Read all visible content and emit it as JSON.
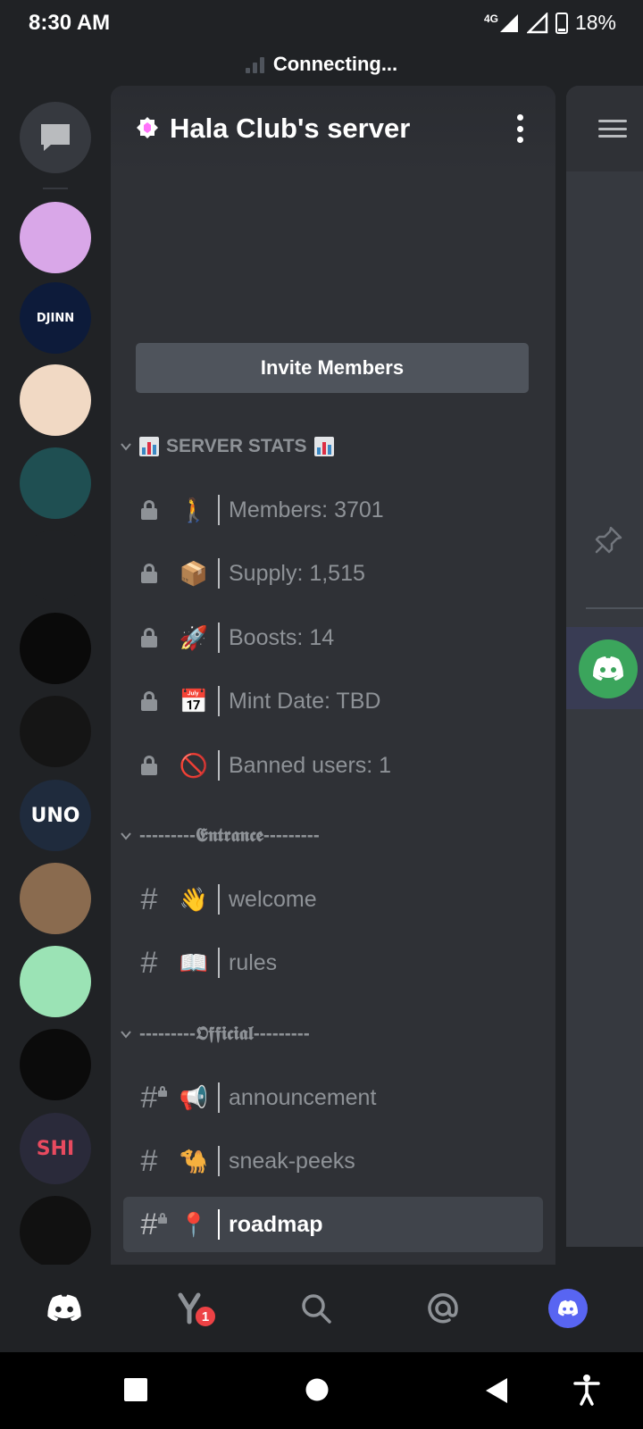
{
  "status_bar": {
    "time": "8:30 AM",
    "network": "4G",
    "battery_percent": "18%"
  },
  "connection_banner": {
    "text": "Connecting..."
  },
  "server": {
    "name": "Hala Club's server",
    "invite_label": "Invite Members"
  },
  "categories": [
    {
      "label": "SERVER STATS",
      "channels": [
        {
          "type": "locked-voice",
          "emoji": "🚶",
          "name": "Members: 3701"
        },
        {
          "type": "locked-voice",
          "emoji": "📦",
          "name": "Supply: 1,515"
        },
        {
          "type": "locked-voice",
          "emoji": "🚀",
          "name": "Boosts: 14"
        },
        {
          "type": "locked-voice",
          "emoji": "📅",
          "name": "Mint Date: TBD"
        },
        {
          "type": "locked-voice",
          "emoji": "🚫",
          "name": "Banned users: 1"
        }
      ]
    },
    {
      "label": "---------𝕰𝖓𝖙𝖗𝖆𝖓𝖈𝖊---------",
      "channels": [
        {
          "type": "text",
          "emoji": "👋",
          "name": "welcome"
        },
        {
          "type": "text",
          "emoji": "📖",
          "name": "rules"
        }
      ]
    },
    {
      "label": "---------𝕺𝖋𝖋𝖎𝖈𝖎𝖆𝖑---------",
      "channels": [
        {
          "type": "locked-text",
          "emoji": "📢",
          "name": "announcement"
        },
        {
          "type": "text",
          "emoji": "🐪",
          "name": "sneak-peeks"
        },
        {
          "type": "locked-text",
          "emoji": "📍",
          "name": "roadmap",
          "active": true
        }
      ]
    }
  ],
  "guilds": [
    {
      "name": "anime-girl-server",
      "color": "#d9a7e8",
      "initials": ""
    },
    {
      "name": "djinn-guild-games",
      "color": "#0d1b3a",
      "initials": "DJINN"
    },
    {
      "name": "great-wave-server",
      "color": "#f1d9c4",
      "initials": ""
    },
    {
      "name": "b-logo-server",
      "color": "#1f4f52",
      "initials": ""
    },
    {
      "name": "purple-cube-server",
      "color": "#202225",
      "initials": ""
    },
    {
      "name": "neon-b-server",
      "color": "#0a0a0a",
      "initials": ""
    },
    {
      "name": "obs-server",
      "color": "#151515",
      "initials": ""
    },
    {
      "name": "uno-server",
      "color": "#1f2b3d",
      "initials": "UNO"
    },
    {
      "name": "ape-art-server",
      "color": "#8a6b4f",
      "initials": ""
    },
    {
      "name": "island-server",
      "color": "#9be3b5",
      "initials": ""
    },
    {
      "name": "burst-server",
      "color": "#0b0b0b",
      "initials": ""
    },
    {
      "name": "shi-server",
      "color": "#2a2a3a",
      "initials": "SHI"
    },
    {
      "name": "g-logo-server",
      "color": "#111111",
      "initials": ""
    }
  ],
  "bottom_nav": {
    "friends_badge": "1"
  },
  "colors": {
    "background": "#202225",
    "panel": "#2f3136",
    "active_channel": "#40444b",
    "button": "#4f545c",
    "blurple": "#5865f2",
    "badge": "#ed4245",
    "online_green": "#3ba55c"
  }
}
